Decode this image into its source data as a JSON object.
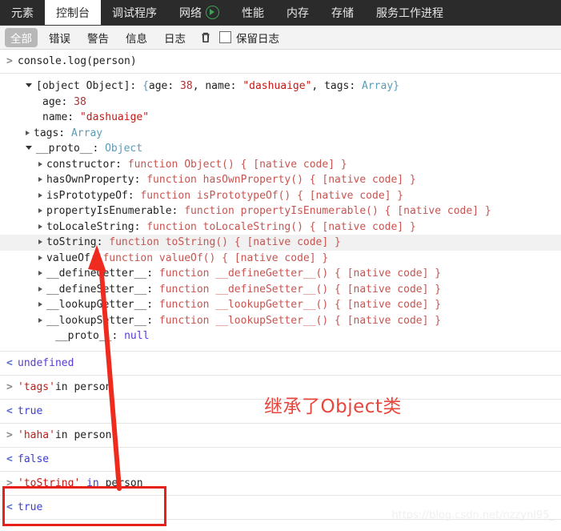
{
  "tabs": [
    {
      "label": "元素",
      "active": false,
      "icon": null
    },
    {
      "label": "控制台",
      "active": true,
      "icon": null
    },
    {
      "label": "调试程序",
      "active": false,
      "icon": null
    },
    {
      "label": "网络",
      "active": false,
      "icon": "record-icon"
    },
    {
      "label": "性能",
      "active": false,
      "icon": null
    },
    {
      "label": "内存",
      "active": false,
      "icon": null
    },
    {
      "label": "存储",
      "active": false,
      "icon": null
    },
    {
      "label": "服务工作进程",
      "active": false,
      "icon": null
    }
  ],
  "filterbar": {
    "filters": [
      {
        "label": "全部",
        "selected": true
      },
      {
        "label": "错误",
        "selected": false
      },
      {
        "label": "警告",
        "selected": false
      },
      {
        "label": "信息",
        "selected": false
      },
      {
        "label": "日志",
        "selected": false
      }
    ],
    "clear_icon": "trash-icon",
    "preserve_log_label": "保留日志",
    "preserve_log_checked": false
  },
  "console": {
    "command_1": "console.log(person)",
    "object": {
      "header": {
        "prefix": "[object Object]: ",
        "brace_open": "{",
        "age_key": "age: ",
        "age_value": "38",
        "comma1": ", ",
        "name_key": "name: ",
        "name_value": "\"dashuaige\"",
        "comma2": ", ",
        "tags_key": "tags: ",
        "tags_value": "Array",
        "brace_close": "}"
      },
      "props": [
        {
          "indent": 2,
          "arrow": "none",
          "key": "age: ",
          "value": "38",
          "vtype": "num"
        },
        {
          "indent": 2,
          "arrow": "none",
          "key": "name: ",
          "value": "\"dashuaige\"",
          "vtype": "str"
        },
        {
          "indent": 1,
          "arrow": "closed",
          "key": "tags: ",
          "value": "Array",
          "vtype": "cls"
        },
        {
          "indent": 1,
          "arrow": "open",
          "key": "__proto__: ",
          "value": "Object",
          "vtype": "cls"
        },
        {
          "indent": 2,
          "arrow": "closed",
          "key": "constructor: ",
          "value": "function Object() { [native code] }",
          "vtype": "fn"
        },
        {
          "indent": 2,
          "arrow": "closed",
          "key": "hasOwnProperty: ",
          "value": "function hasOwnProperty() { [native code] }",
          "vtype": "fn"
        },
        {
          "indent": 2,
          "arrow": "closed",
          "key": "isPrototypeOf: ",
          "value": "function isPrototypeOf() { [native code] }",
          "vtype": "fn"
        },
        {
          "indent": 2,
          "arrow": "closed",
          "key": "propertyIsEnumerable: ",
          "value": "function propertyIsEnumerable() { [native code] }",
          "vtype": "fn"
        },
        {
          "indent": 2,
          "arrow": "closed",
          "key": "toLocaleString: ",
          "value": "function toLocaleString() { [native code] }",
          "vtype": "fn"
        },
        {
          "indent": 2,
          "arrow": "closed",
          "key": "toString: ",
          "value": "function toString() { [native code] }",
          "vtype": "fn",
          "highlight": true
        },
        {
          "indent": 2,
          "arrow": "closed",
          "key": "valueOf: ",
          "value": "function valueOf() { [native code] }",
          "vtype": "fn"
        },
        {
          "indent": 2,
          "arrow": "closed",
          "key": "__defineGetter__: ",
          "value": "function __defineGetter__() { [native code] }",
          "vtype": "fn"
        },
        {
          "indent": 2,
          "arrow": "closed",
          "key": "__defineSetter__: ",
          "value": "function __defineSetter__() { [native code] }",
          "vtype": "fn"
        },
        {
          "indent": 2,
          "arrow": "closed",
          "key": "__lookupGetter__: ",
          "value": "function __lookupGetter__() { [native code] }",
          "vtype": "fn"
        },
        {
          "indent": 2,
          "arrow": "closed",
          "key": "__lookupSetter__: ",
          "value": "function __lookupSetter__() { [native code] }",
          "vtype": "fn"
        },
        {
          "indent": 3,
          "arrow": "none",
          "key": "__proto__: ",
          "value": "null",
          "vtype": "nul"
        }
      ]
    },
    "result_1": "undefined",
    "command_2_str": "'tags'",
    "command_2_rest": "in person",
    "result_2": "true",
    "command_3_str": "'haha'",
    "command_3_rest": "in person",
    "result_3": "false",
    "command_4_str": "'toString'",
    "command_4_kw": " in ",
    "command_4_rest": "person",
    "result_4": "true",
    "prompt_in": ">",
    "prompt_out": "<"
  },
  "annotations": {
    "note_text": "继承了Object类",
    "note_color": "#e8463c",
    "box_color": "#e8201a",
    "arrow_color": "#ef2b20"
  },
  "watermark": "https://blog.csdn.net/nzzynl95_"
}
